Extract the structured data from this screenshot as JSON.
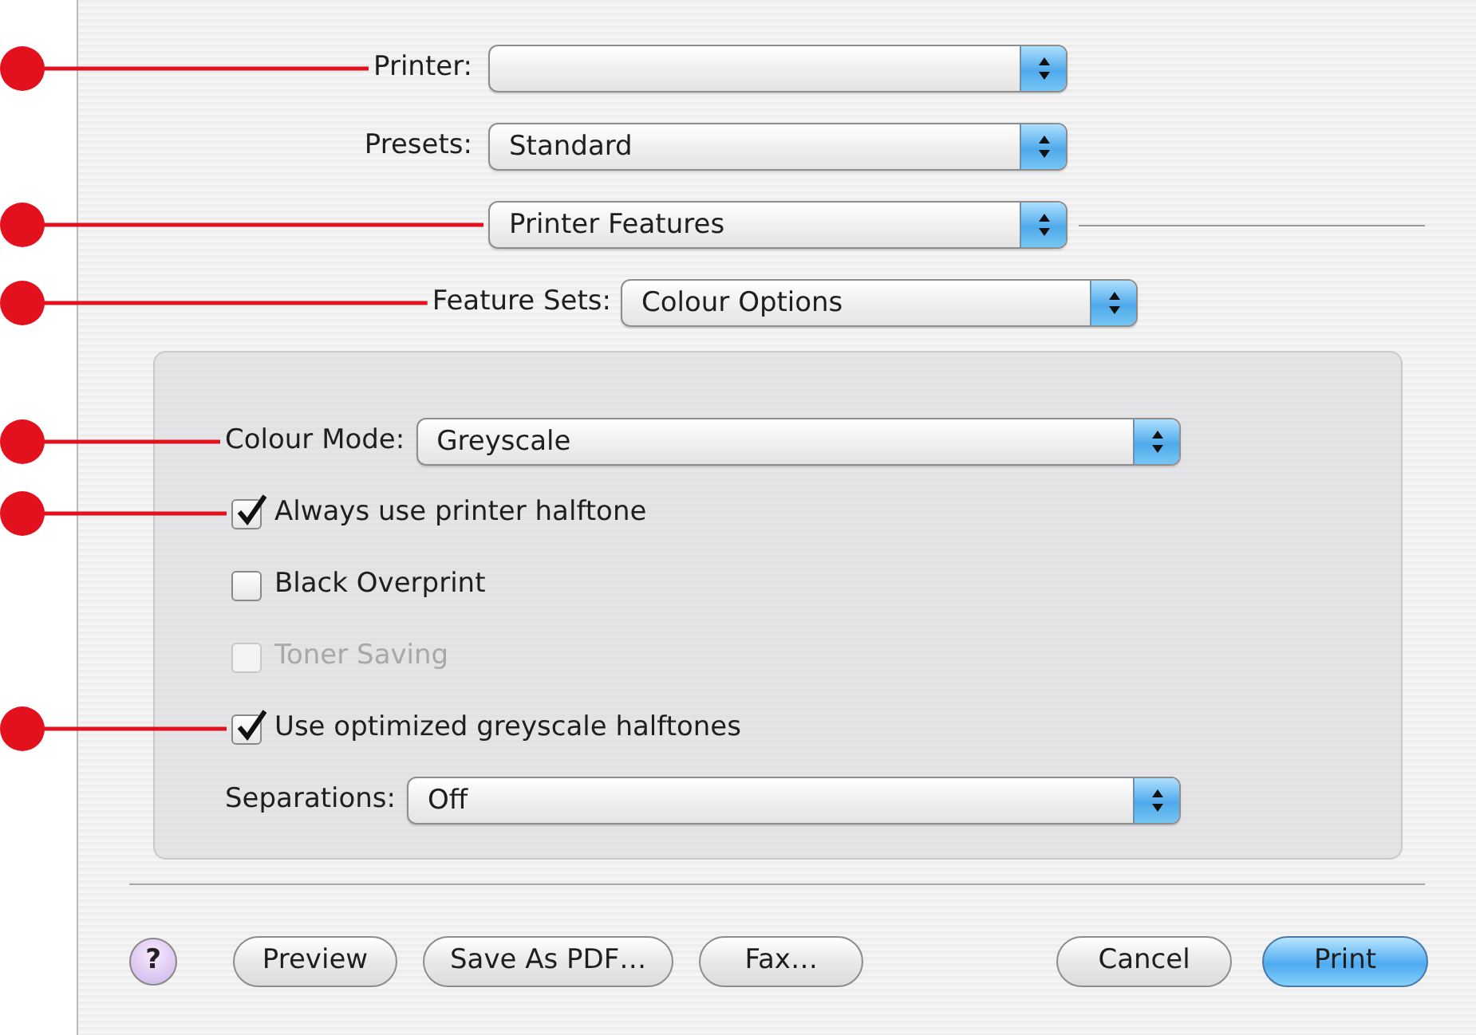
{
  "printer": {
    "label": "Printer:",
    "callout": true
  },
  "presets": {
    "label": "Presets:",
    "value": "Standard"
  },
  "pane_menu": {
    "value": "Printer Features",
    "callout": true
  },
  "feature_sets": {
    "label": "Feature Sets:",
    "value": "Colour Options",
    "callout": true
  },
  "options": [
    {
      "kind": "popup",
      "label": "Colour Mode:",
      "value": "Greyscale",
      "callout": true
    },
    {
      "kind": "checkbox",
      "label": "Always use printer halftone",
      "checked": true,
      "disabled": false,
      "callout": true
    },
    {
      "kind": "checkbox",
      "label": "Black Overprint",
      "checked": false,
      "disabled": false
    },
    {
      "kind": "checkbox",
      "label": "Toner Saving",
      "checked": false,
      "disabled": true
    },
    {
      "kind": "checkbox",
      "label": "Use optimized greyscale halftones",
      "checked": true,
      "disabled": false,
      "callout": true
    },
    {
      "kind": "popup",
      "label": "Separations:",
      "value": "Off"
    }
  ],
  "help_button": "?",
  "buttons_left": [
    {
      "label": "Preview",
      "default": false
    },
    {
      "label": "Save As PDF…",
      "default": false
    },
    {
      "label": "Fax…",
      "default": false
    }
  ],
  "buttons_right": [
    {
      "label": "Cancel",
      "default": false
    },
    {
      "label": "Print",
      "default": true
    }
  ]
}
